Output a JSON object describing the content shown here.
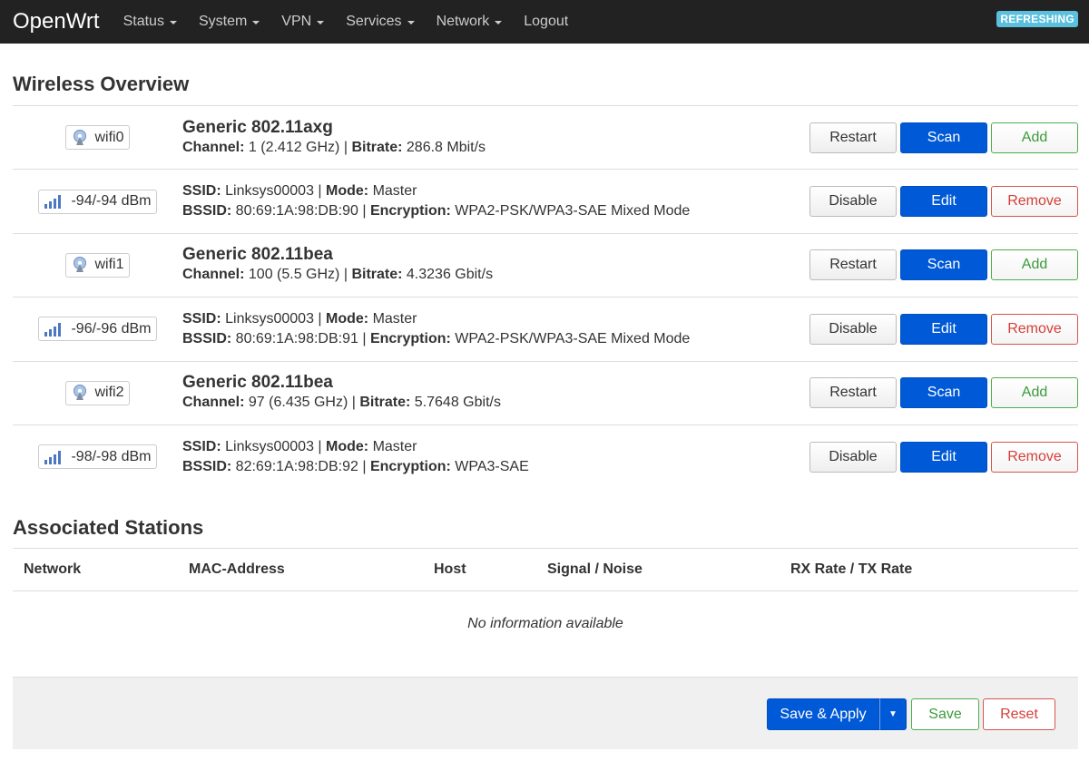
{
  "header": {
    "brand": "OpenWrt",
    "menu": [
      {
        "label": "Status",
        "dropdown": true
      },
      {
        "label": "System",
        "dropdown": true
      },
      {
        "label": "VPN",
        "dropdown": true
      },
      {
        "label": "Services",
        "dropdown": true
      },
      {
        "label": "Network",
        "dropdown": true
      },
      {
        "label": "Logout",
        "dropdown": false
      }
    ],
    "status_badge": "REFRESHING"
  },
  "wireless": {
    "title": "Wireless Overview",
    "rows": [
      {
        "kind": "device",
        "badge": "wifi0",
        "name": "Generic 802.11axg",
        "l1": "Channel:",
        "v1": " 1 (2.412 GHz) | ",
        "l2": "Bitrate:",
        "v2": " 286.8 Mbit/s",
        "buttons": [
          "Restart",
          "Scan",
          "Add"
        ]
      },
      {
        "kind": "network",
        "badge": "-94/-94 dBm",
        "ssid_label": "SSID:",
        "ssid": " Linksys00003 | ",
        "mode_label": "Mode:",
        "mode": " Master",
        "bssid_label": "BSSID:",
        "bssid": " 80:69:1A:98:DB:90 | ",
        "enc_label": "Encryption:",
        "enc": " WPA2-PSK/WPA3-SAE Mixed Mode",
        "buttons": [
          "Disable",
          "Edit",
          "Remove"
        ]
      },
      {
        "kind": "device",
        "badge": "wifi1",
        "name": "Generic 802.11bea",
        "l1": "Channel:",
        "v1": " 100 (5.5 GHz) | ",
        "l2": "Bitrate:",
        "v2": " 4.3236 Gbit/s",
        "buttons": [
          "Restart",
          "Scan",
          "Add"
        ]
      },
      {
        "kind": "network",
        "badge": "-96/-96 dBm",
        "ssid_label": "SSID:",
        "ssid": " Linksys00003 | ",
        "mode_label": "Mode:",
        "mode": " Master",
        "bssid_label": "BSSID:",
        "bssid": " 80:69:1A:98:DB:91 | ",
        "enc_label": "Encryption:",
        "enc": " WPA2-PSK/WPA3-SAE Mixed Mode",
        "buttons": [
          "Disable",
          "Edit",
          "Remove"
        ]
      },
      {
        "kind": "device",
        "badge": "wifi2",
        "name": "Generic 802.11bea",
        "l1": "Channel:",
        "v1": " 97 (6.435 GHz) | ",
        "l2": "Bitrate:",
        "v2": " 5.7648 Gbit/s",
        "buttons": [
          "Restart",
          "Scan",
          "Add"
        ]
      },
      {
        "kind": "network",
        "badge": "-98/-98 dBm",
        "ssid_label": "SSID:",
        "ssid": " Linksys00003 | ",
        "mode_label": "Mode:",
        "mode": " Master",
        "bssid_label": "BSSID:",
        "bssid": " 82:69:1A:98:DB:92 | ",
        "enc_label": "Encryption:",
        "enc": " WPA3-SAE",
        "buttons": [
          "Disable",
          "Edit",
          "Remove"
        ]
      }
    ]
  },
  "stations": {
    "title": "Associated Stations",
    "columns": [
      "Network",
      "MAC-Address",
      "Host",
      "Signal / Noise",
      "RX Rate / TX Rate"
    ],
    "empty": "No information available"
  },
  "footer": {
    "save_apply": "Save & Apply",
    "save": "Save",
    "reset": "Reset"
  }
}
